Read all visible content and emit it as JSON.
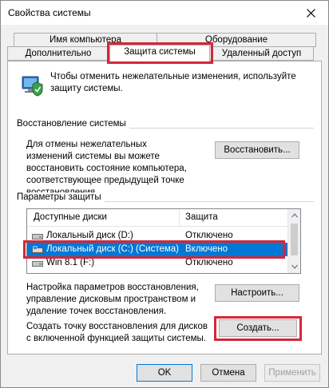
{
  "window": {
    "title": "Свойства системы"
  },
  "tabs": {
    "row1": [
      "Имя компьютера",
      "Оборудование"
    ],
    "row2": [
      "Дополнительно",
      "Защита системы",
      "Удаленный доступ"
    ]
  },
  "intro": {
    "text": "Чтобы отменить нежелательные изменения, используйте защиту системы."
  },
  "restore": {
    "group_label": "Восстановление системы",
    "description": "Для отмены нежелательных изменений системы вы можете восстановить состояние компьютера, соответствующее предыдущей точке восстановления.",
    "button": "Восстановить..."
  },
  "protection": {
    "group_label": "Параметры защиты",
    "columns": [
      "Доступные диски",
      "Защита"
    ],
    "rows": [
      {
        "name": "Локальный диск (D:)",
        "state": "Отключено",
        "icon": "hard-drive-icon"
      },
      {
        "name": "Локальный диск (C:) (Система)",
        "state": "Включено",
        "icon": "system-drive-icon"
      },
      {
        "name": "Win 8.1 (F:)",
        "state": "Отключено",
        "icon": "hard-drive-icon"
      }
    ],
    "configure_text": "Настройка параметров восстановления, управление дисковым пространством и удаление точек восстановления.",
    "configure_button": "Настроить...",
    "create_text": "Создать точку восстановления для дисков с включенной функцией защиты системы.",
    "create_button": "Создать..."
  },
  "footer": {
    "ok": "OK",
    "cancel": "Отмена",
    "apply": "Применить"
  },
  "colors": {
    "highlight": "#d22838",
    "selection": "#0078d7",
    "accent": "#0078d7"
  }
}
